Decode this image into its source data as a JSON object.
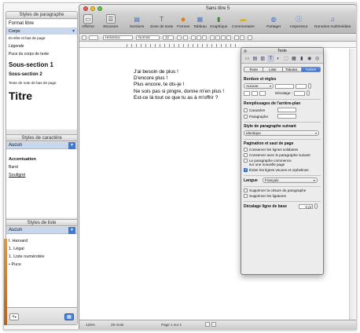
{
  "window": {
    "title": "Sans titre 5"
  },
  "toolbar": {
    "items": [
      {
        "label": "Afficher",
        "icon": "view-icon"
      },
      {
        "label": "Structure",
        "icon": "outline-icon"
      },
      {
        "label": "Sections",
        "icon": "sections-icon"
      },
      {
        "label": "Zone de texte",
        "icon": "textbox-icon"
      },
      {
        "label": "Formes",
        "icon": "shapes-icon"
      },
      {
        "label": "Tableau",
        "icon": "table-icon"
      },
      {
        "label": "Graphique",
        "icon": "chart-icon"
      },
      {
        "label": "Commentaire",
        "icon": "comment-icon"
      },
      {
        "label": "Partager",
        "icon": "share-icon"
      },
      {
        "label": "Inspecteur",
        "icon": "inspector-icon"
      },
      {
        "label": "Données multimédias",
        "icon": "media-icon"
      }
    ]
  },
  "formatbar": {
    "font": "Helvetica",
    "style": "Normal",
    "size": "12"
  },
  "styles_drawer": {
    "paragraph": {
      "title": "Styles de paragraphe",
      "items": [
        "Format libre",
        "Corps",
        "En-tête et bas de page",
        "Légende",
        "Puce du corps de texte",
        "Sous-section 1",
        "Sous-section 2",
        "Texte de note de bas de page",
        "Titre"
      ],
      "selected": "Corps"
    },
    "character": {
      "title": "Styles de caractère",
      "selected": "Aucun",
      "items": [
        "Accentuation",
        "Barré",
        "Souligné"
      ]
    },
    "list": {
      "title": "Styles de liste",
      "selected": "Aucun",
      "items": [
        "I. Harvard",
        "1. Légal",
        "1. Liste numérotée",
        "• Puce"
      ]
    }
  },
  "document": {
    "lines": [
      "J'ai besoin de plus !",
      "D'encore plus !",
      "Plus encore, te dis-je !",
      "Ne sois pas si pingre, donne m'en plus !",
      "Est-ce là tout ce que tu as à m'offrir ?"
    ]
  },
  "statusbar": {
    "zoom": "125%",
    "words": "29 mots",
    "page": "Page 1 sur 1"
  },
  "inspector": {
    "title": "Texte",
    "tabs": [
      "Texte",
      "Liste",
      "Tabulat.",
      "Autres"
    ],
    "active_tab": "Autres",
    "borders": {
      "heading": "Bordure et règles",
      "style": "Aucune",
      "offset_label": "Décalage :"
    },
    "background": {
      "heading": "Remplissages de l'arrière-plan",
      "character_label": "Caractère",
      "paragraph_label": "Paragraphe"
    },
    "next_style": {
      "heading": "Style de paragraphe suivant",
      "value": "Identique"
    },
    "pagination": {
      "heading": "Pagination et saut de page",
      "options": [
        {
          "label": "Conserver les lignes solidaires",
          "checked": false
        },
        {
          "label": "Conserver avec le paragraphe suivant",
          "checked": false
        },
        {
          "label": "Le paragraphe commence sur une nouvelle page",
          "checked": false
        },
        {
          "label": "Éviter les lignes veuves et orphelines",
          "checked": true
        }
      ]
    },
    "language": {
      "label": "Langue",
      "value": "Français"
    },
    "hyphenation": [
      {
        "label": "Supprimer la césure du paragraphe",
        "checked": false
      },
      {
        "label": "Supprimer les ligatures",
        "checked": false
      }
    ],
    "baseline": {
      "label": "Décalage ligne de base",
      "value": "0 pt"
    }
  }
}
